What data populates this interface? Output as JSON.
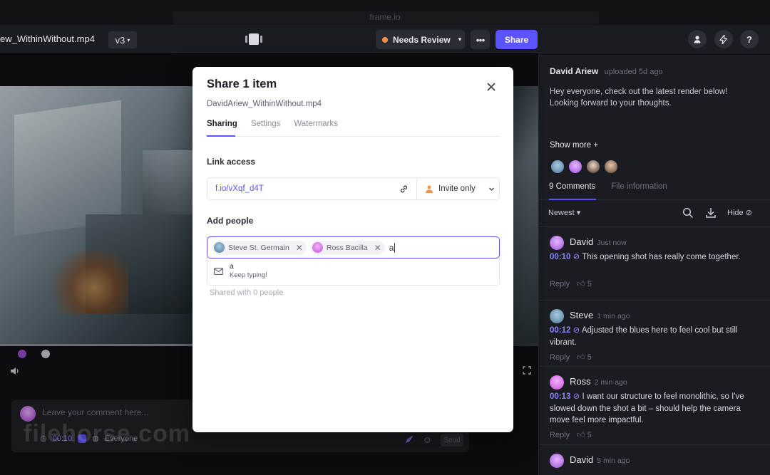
{
  "window": {
    "title": "frame.io"
  },
  "toolbar": {
    "filename": "ew_WithinWithout.mp4",
    "version": "v3",
    "status": "Needs Review",
    "more": "•••",
    "share": "Share",
    "round_buttons": [
      {
        "icon": "user-icon",
        "glyph": "●"
      },
      {
        "icon": "lightning-icon",
        "glyph": "⚡"
      },
      {
        "icon": "help-icon",
        "glyph": "?"
      }
    ]
  },
  "comment_composer": {
    "placeholder": "Leave your comment here...",
    "time": "00:10",
    "audience": "Everyone",
    "send": "Send"
  },
  "watermark": "filehorse.com",
  "panel": {
    "uploader_name": "David Ariew",
    "uploader_meta": "uploaded 5d ago",
    "description": "Hey everyone, check out the latest render below! Looking forward to your thoughts.",
    "show_more": "Show more +",
    "tabs": [
      "9 Comments",
      "File information"
    ],
    "sort": "Newest",
    "hide": "Hide",
    "comments": [
      {
        "author": "David",
        "ago": "Just now",
        "time": "00:10",
        "text": "This opening shot has really come together.",
        "reply": "Reply",
        "likes": "5",
        "avatar_color": "#9a4fd6"
      },
      {
        "author": "Steve",
        "ago": "1 min ago",
        "time": "00:12",
        "text": "Adjusted the blues here to feel cool but still vibrant.",
        "reply": "Reply",
        "likes": "5",
        "avatar_color": "#5c8aa8"
      },
      {
        "author": "Ross",
        "ago": "2 min ago",
        "time": "00:13",
        "text": "I want our structure to feel monolithic, so I've slowed down the shot a bit – should help the camera move feel more impactful.",
        "reply": "Reply",
        "likes": "5",
        "avatar_color": "#c44fd9"
      },
      {
        "author": "David",
        "ago": "5 min ago",
        "time": "",
        "text": "",
        "reply": "",
        "likes": "",
        "avatar_color": "#9a4fd6"
      }
    ]
  },
  "modal": {
    "title": "Share 1 item",
    "filename": "DavidAriew_WithinWithout.mp4",
    "tabs": [
      "Sharing",
      "Settings",
      "Watermarks"
    ],
    "link_access_label": "Link access",
    "link_url": "f.io/vXqf_d4T",
    "access_level": "Invite only",
    "add_people_label": "Add people",
    "chips": [
      {
        "name": "Steve St. Germain",
        "color": "#5c8aa8"
      },
      {
        "name": "Ross Bacilla",
        "color": "#c44fd9"
      }
    ],
    "typed": "a",
    "suggestion_title": "a",
    "suggestion_hint": "Keep typing!",
    "shared_with": "Shared with 0 people"
  },
  "colors": {
    "accent": "#5b53ff",
    "status": "#f1924a",
    "timecode": "#8b84ff"
  }
}
